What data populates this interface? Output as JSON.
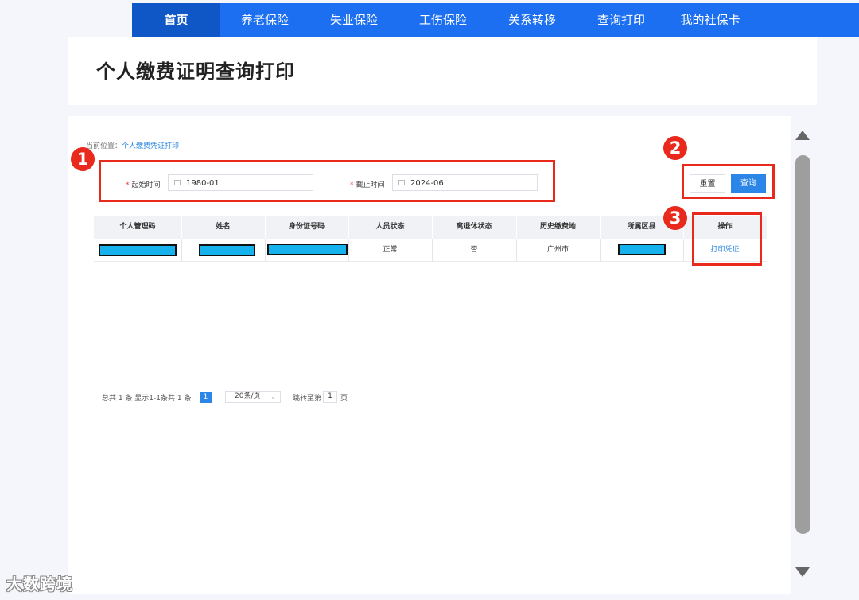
{
  "nav": {
    "items": [
      {
        "label": "首页",
        "active": true
      },
      {
        "label": "养老保险"
      },
      {
        "label": "失业保险"
      },
      {
        "label": "工伤保险"
      },
      {
        "label": "关系转移"
      },
      {
        "label": "查询打印"
      },
      {
        "label": "我的社保卡"
      }
    ]
  },
  "page": {
    "title": "个人缴费证明查询打印"
  },
  "breadcrumb": {
    "prefix": "当前位置：",
    "current": "个人缴费凭证打印"
  },
  "form": {
    "start": {
      "label": "起始时间",
      "value": "1980-01"
    },
    "end": {
      "label": "截止时间",
      "value": "2024-06"
    },
    "reset_label": "重置",
    "query_label": "查询"
  },
  "table": {
    "headers": [
      "个人管理码",
      "姓名",
      "身份证号码",
      "人员状态",
      "离退休状态",
      "历史缴费地",
      "所属区县",
      "操作"
    ],
    "row": {
      "status": "正常",
      "retired": "否",
      "location": "广州市",
      "action": "打印凭证"
    }
  },
  "pagination": {
    "summary": "总共 1 条 显示1-1条共 1 条",
    "current_page": "1",
    "page_size": "20条/页",
    "jump_prefix": "跳转至第",
    "jump_value": "1",
    "jump_suffix": "页"
  },
  "annotations": {
    "badge1": "1",
    "badge2": "2",
    "badge3": "3"
  },
  "watermark": "大数跨境",
  "colors": {
    "nav": "#1b6ff0",
    "accent": "#2c86e8",
    "annotation": "#e8291c",
    "redaction": "#15b2ee"
  }
}
